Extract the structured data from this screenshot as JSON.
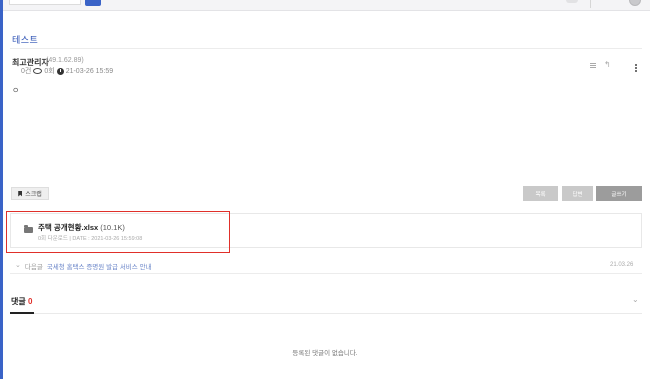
{
  "board": {
    "title": "테스트"
  },
  "post": {
    "author": "최고관리자",
    "ip": "(49.1.62.89)",
    "comments": "0건",
    "views": "0회",
    "datetime": "21-03-26 15:59",
    "content": "ㅇ"
  },
  "buttons": {
    "scrap": "스크랩",
    "list": "목록",
    "reply": "답변",
    "write": "글쓰기"
  },
  "file": {
    "name": "주택 공개현황.xlsx",
    "size": "(10.1K)",
    "info": "0회 다운로드 | DATE : 2021-03-26 15:59:08"
  },
  "nav": {
    "next_label": "다음글",
    "next_title": "국세청 홈택스 증명원 발급 서비스 안내",
    "next_date": "21.03.26"
  },
  "comments": {
    "tab_label": "댓글",
    "count": "0",
    "empty_text": "등록된 댓글이 없습니다."
  },
  "colors": {
    "accent": "#3a63c7",
    "highlight": "#e0302a",
    "button_gray": "#c9c9c9",
    "button_dark": "#9c9c9c"
  },
  "icons": [
    "search-icon",
    "eye-icon",
    "clock-icon",
    "list-icon",
    "reply-icon",
    "more-icon",
    "bookmark-icon",
    "folder-icon",
    "chevron-down-icon",
    "avatar"
  ]
}
